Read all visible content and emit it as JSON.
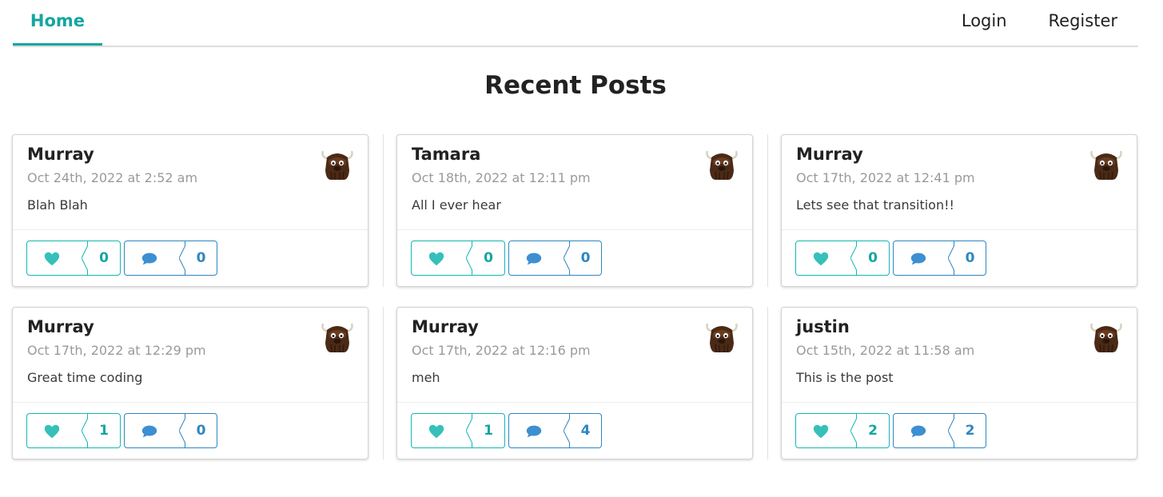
{
  "nav": {
    "home": "Home",
    "login": "Login",
    "register": "Register"
  },
  "page": {
    "title": "Recent Posts"
  },
  "colors": {
    "accent_teal": "#14a6a1",
    "accent_blue": "#2e86c1"
  },
  "icons": {
    "like": "heart-icon",
    "comment": "comment-icon",
    "avatar": "yak-avatar"
  },
  "posts": [
    {
      "author": "Murray",
      "date": "Oct 24th, 2022 at 2:52 am",
      "body": "Blah Blah",
      "likes": "0",
      "comments": "0"
    },
    {
      "author": "Tamara",
      "date": "Oct 18th, 2022 at 12:11 pm",
      "body": "All I ever hear",
      "likes": "0",
      "comments": "0"
    },
    {
      "author": "Murray",
      "date": "Oct 17th, 2022 at 12:41 pm",
      "body": "Lets see that transition!!",
      "likes": "0",
      "comments": "0"
    },
    {
      "author": "Murray",
      "date": "Oct 17th, 2022 at 12:29 pm",
      "body": "Great time coding",
      "likes": "1",
      "comments": "0"
    },
    {
      "author": "Murray",
      "date": "Oct 17th, 2022 at 12:16 pm",
      "body": "meh",
      "likes": "1",
      "comments": "4"
    },
    {
      "author": "justin",
      "date": "Oct 15th, 2022 at 11:58 am",
      "body": "This is the post",
      "likes": "2",
      "comments": "2"
    }
  ]
}
